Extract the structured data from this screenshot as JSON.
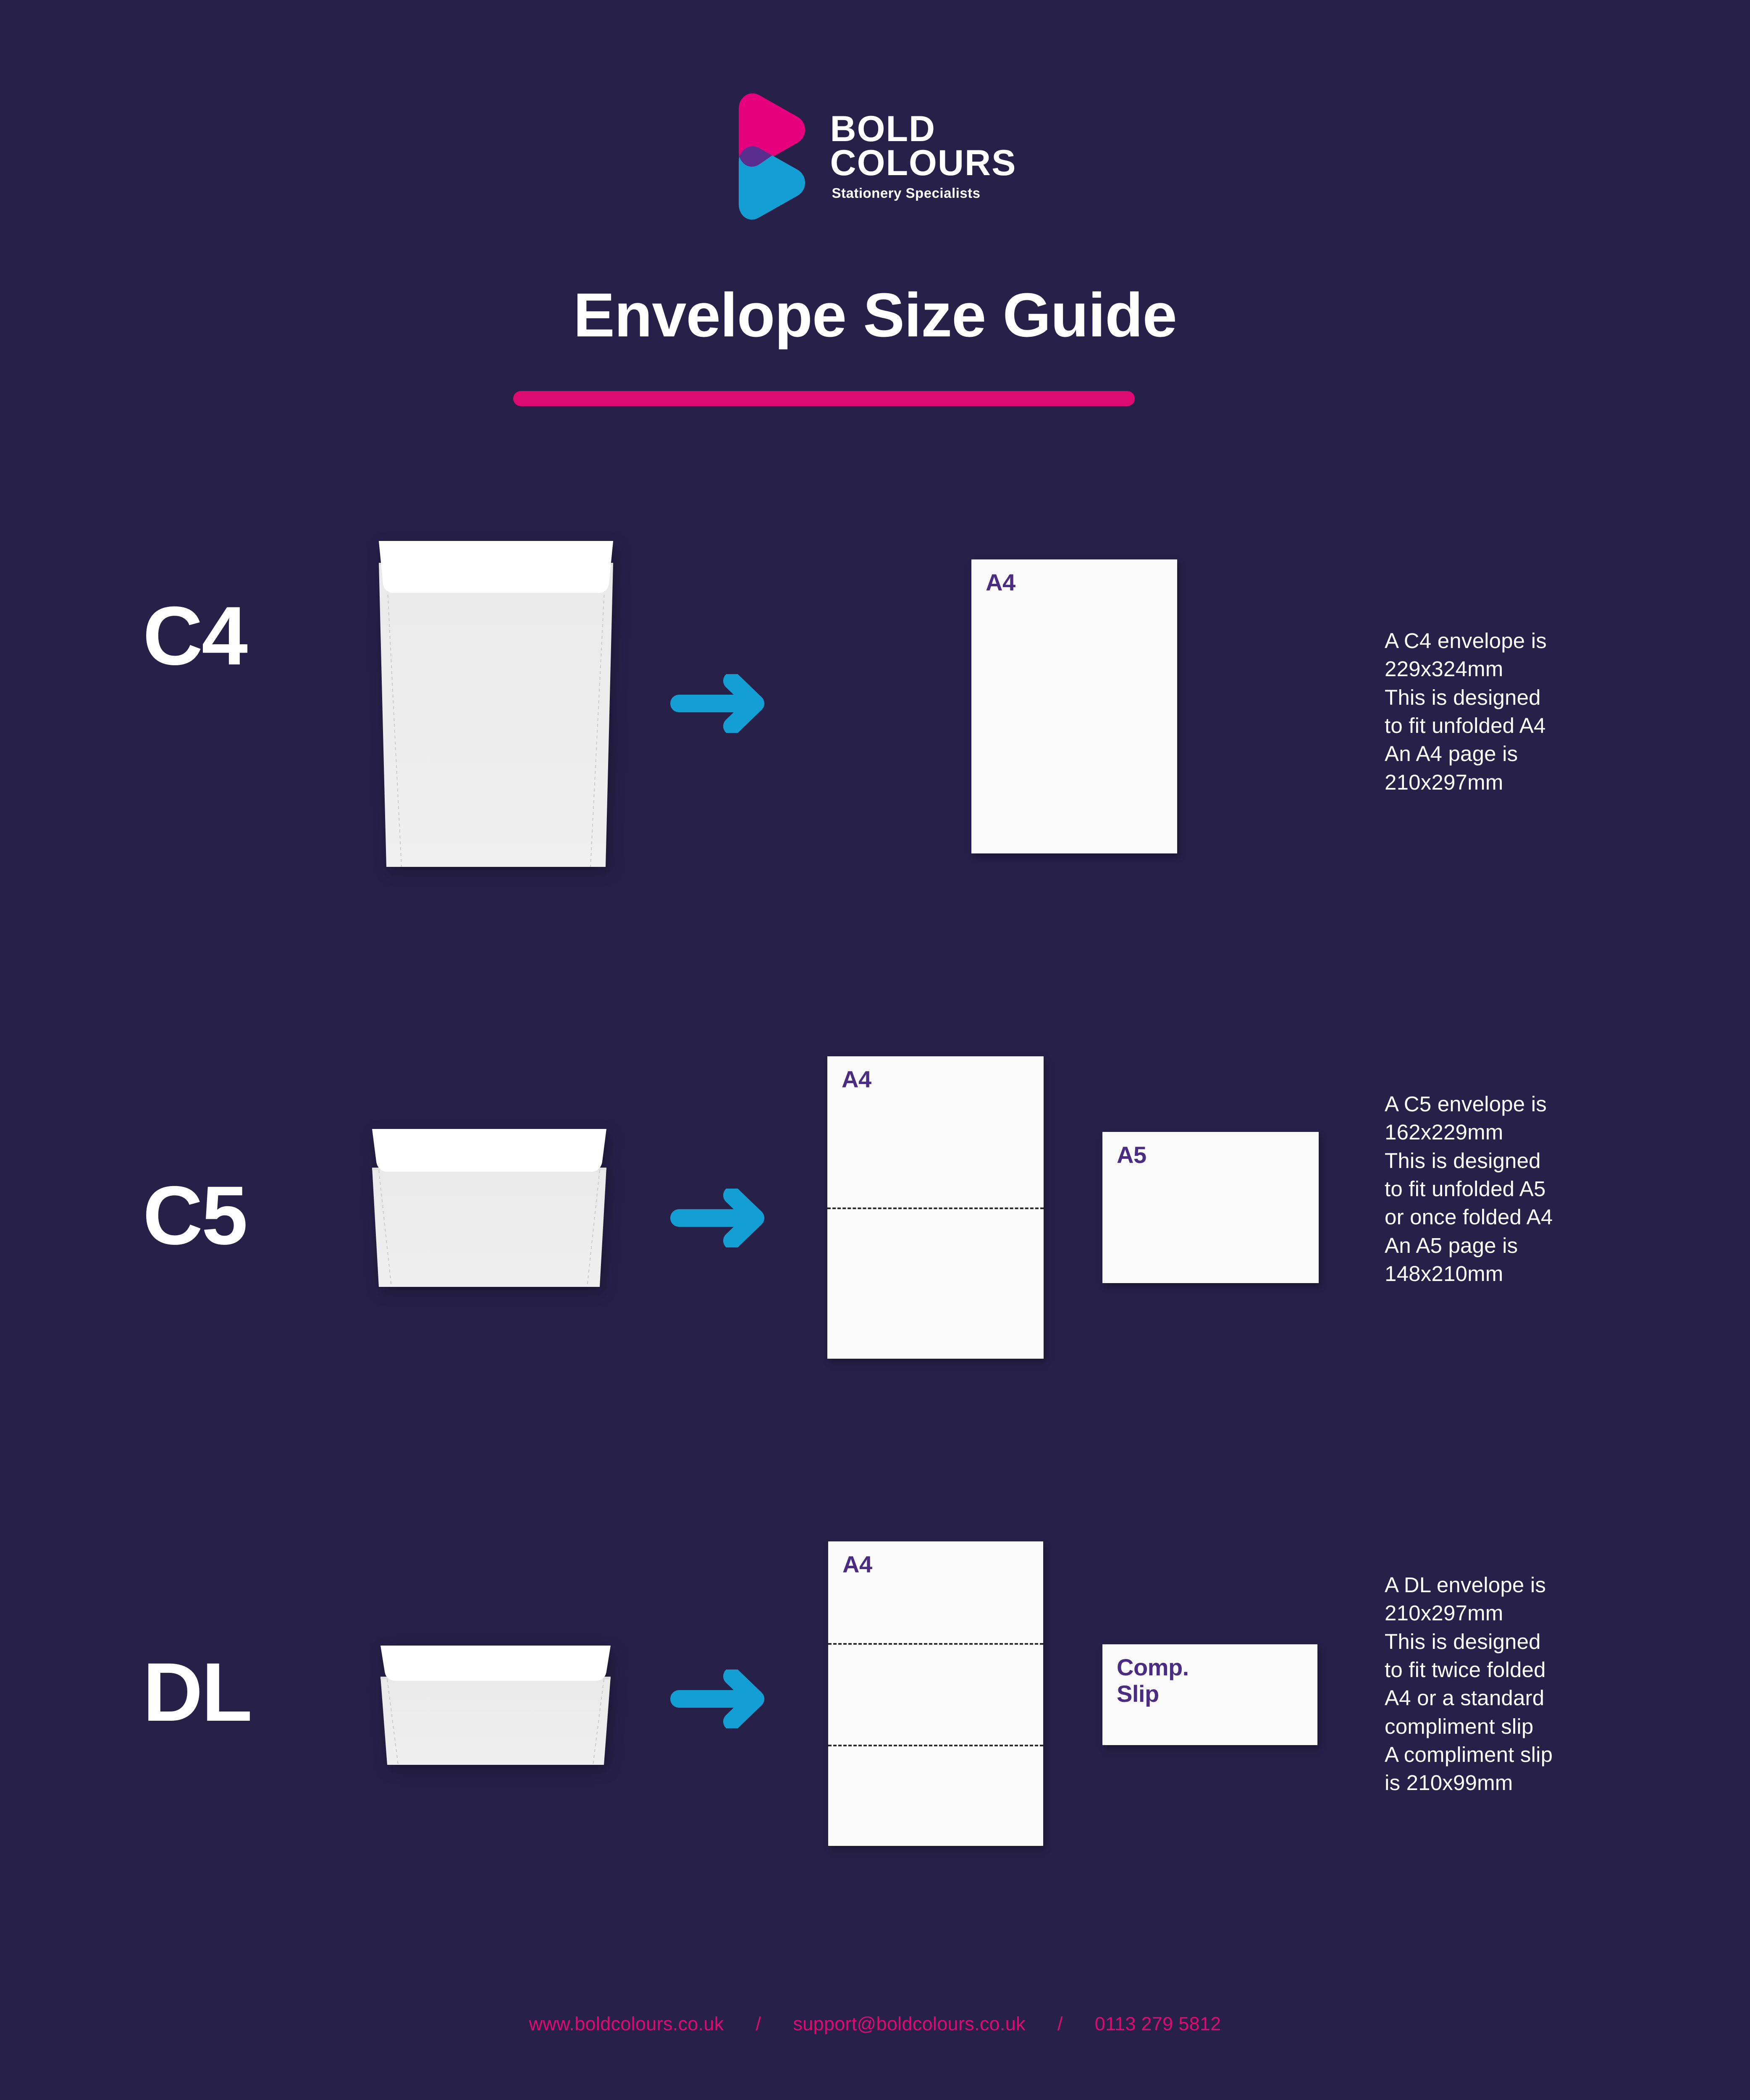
{
  "brand": {
    "name_line1": "BOLD",
    "name_line2": "COLOURS",
    "tagline": "Stationery Specialists",
    "logo_pink": "#E6007E",
    "logo_purple": "#5B2D8E",
    "logo_cyan": "#149FD4"
  },
  "header": {
    "title": "Envelope Size Guide",
    "accent_color": "#DD0A72"
  },
  "theme": {
    "background": "#272049",
    "paper": "#FAFAFA",
    "label_purple": "#4A2C83",
    "arrow_blue": "#149FD4",
    "text_white": "#FFFFFF"
  },
  "sections": [
    {
      "id": "c4",
      "size_label": "C4",
      "arrow_icon": "arrow-right-icon",
      "papers": [
        {
          "label": "A4",
          "folds": 0
        }
      ],
      "description": "A C4 envelope is\n229x324mm\nThis is designed\nto fit unfolded A4\nAn A4 page is\n210x297mm"
    },
    {
      "id": "c5",
      "size_label": "C5",
      "arrow_icon": "arrow-right-icon",
      "papers": [
        {
          "label": "A4",
          "folds": 1
        },
        {
          "label": "A5",
          "folds": 0
        }
      ],
      "description": "A C5 envelope is\n162x229mm\nThis is designed\nto fit unfolded A5\nor once folded A4\nAn A5 page is\n148x210mm"
    },
    {
      "id": "dl",
      "size_label": "DL",
      "arrow_icon": "arrow-right-icon",
      "papers": [
        {
          "label": "A4",
          "folds": 2
        },
        {
          "label": "Comp.\nSlip",
          "folds": 0
        }
      ],
      "description": "A DL envelope is\n210x297mm\nThis is designed\nto fit twice folded\nA4 or a standard\ncompliment slip\nA compliment slip\nis 210x99mm"
    }
  ],
  "footer": {
    "website": "www.boldcolours.co.uk",
    "separator_1": "/",
    "email": "support@boldcolours.co.uk",
    "separator_2": "/",
    "phone": "0113 279 5812"
  }
}
